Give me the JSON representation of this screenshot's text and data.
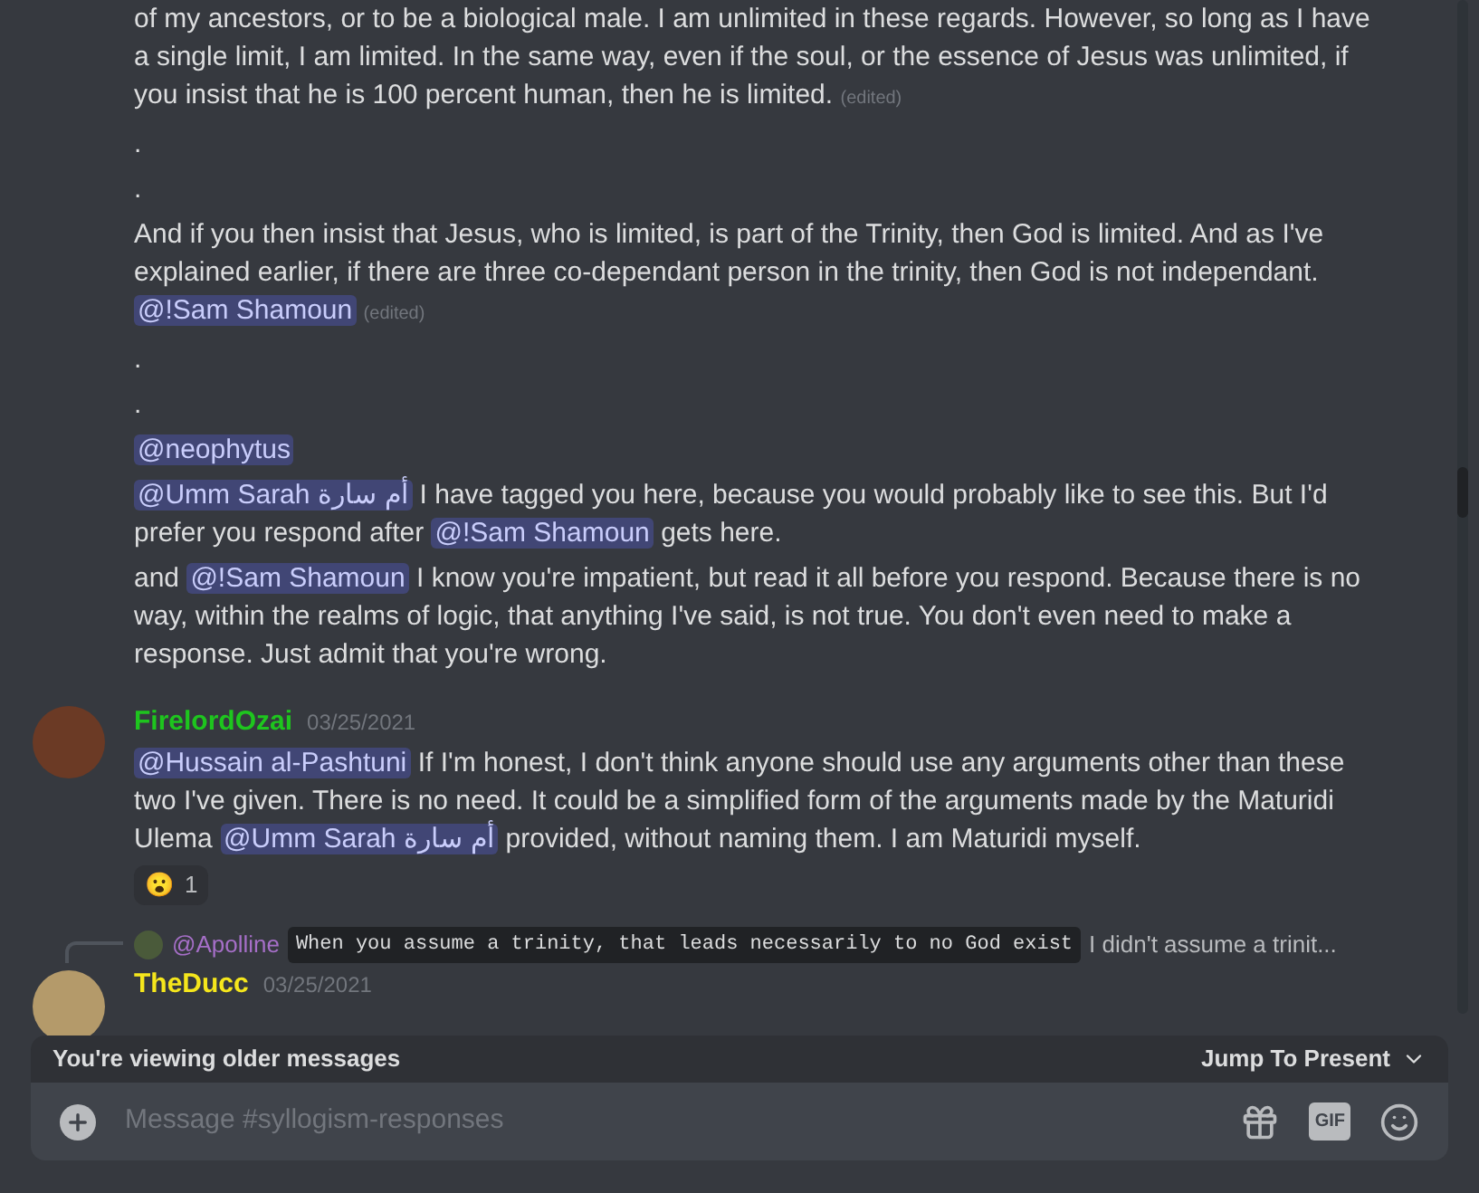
{
  "top_message": {
    "paragraphs": [
      {
        "segments": [
          {
            "kind": "text",
            "text": "of my ancestors, or to be a biological male. I am unlimited in these regards. However, so long as I have a single limit, I am limited. In the same way, even if the soul, or the essence of Jesus was unlimited, if you insist that he is 100 percent human, then he is limited."
          },
          {
            "kind": "edited",
            "text": "(edited)"
          }
        ]
      },
      {
        "segments": [
          {
            "kind": "text",
            "text": "."
          }
        ]
      },
      {
        "segments": [
          {
            "kind": "text",
            "text": "."
          }
        ]
      },
      {
        "segments": [
          {
            "kind": "text",
            "text": "And if you then insist that Jesus, who is limited, is part of the Trinity, then God is limited. And as I've explained earlier, if there are three co-dependant person in the trinity, then God is not independant."
          },
          {
            "kind": "mention",
            "text": "@!Sam Shamoun"
          },
          {
            "kind": "edited",
            "text": "(edited)"
          }
        ]
      },
      {
        "segments": [
          {
            "kind": "text",
            "text": "."
          }
        ]
      },
      {
        "segments": [
          {
            "kind": "text",
            "text": "."
          }
        ]
      },
      {
        "segments": [
          {
            "kind": "mention",
            "text": "@neophytus"
          }
        ]
      },
      {
        "segments": [
          {
            "kind": "mention",
            "text": "@Umm Sarah أم سارة"
          },
          {
            "kind": "text",
            "text": "I have tagged you here, because you would probably like to see this. But I'd prefer you respond after"
          },
          {
            "kind": "mention",
            "text": "@!Sam Shamoun"
          },
          {
            "kind": "text",
            "text": "gets here."
          }
        ]
      },
      {
        "segments": [
          {
            "kind": "text",
            "text": "and"
          },
          {
            "kind": "mention",
            "text": "@!Sam Shamoun"
          },
          {
            "kind": "text",
            "text": "I know you're impatient, but read it all before you respond. Because there is no way, within the realms of logic, that anything I've said, is not true. You don't even need to make a response. Just admit that you're wrong."
          }
        ]
      }
    ]
  },
  "message": {
    "author": "FirelordOzai",
    "color": "#1ec51e",
    "timestamp": "03/25/2021",
    "paragraphs": [
      {
        "segments": [
          {
            "kind": "mention",
            "text": "@Hussain al-Pashtuni"
          },
          {
            "kind": "text",
            "text": "If I'm honest, I don't think anyone should use any arguments other than these two I've given. There is no need. It could be a simplified form of the arguments made by the Maturidi Ulema"
          },
          {
            "kind": "mention",
            "text": "@Umm Sarah أم سارة"
          },
          {
            "kind": "text",
            "text": "provided, without naming them. I am Maturidi myself."
          }
        ]
      }
    ],
    "reaction": {
      "emoji": "😮",
      "count": "1"
    }
  },
  "reply_message": {
    "reply_to": {
      "author": "@Apolline",
      "code": "When you assume a trinity, that leads necessarily to no God exist",
      "text": "I didn't assume a trinit..."
    },
    "author": "TheDucc",
    "color": "#f5e61c",
    "timestamp": "03/25/2021"
  },
  "older_bar": {
    "text": "You're viewing older messages",
    "jump": "Jump To Present"
  },
  "composer": {
    "placeholder": "Message #syllogism-responses",
    "gif": "GIF"
  }
}
